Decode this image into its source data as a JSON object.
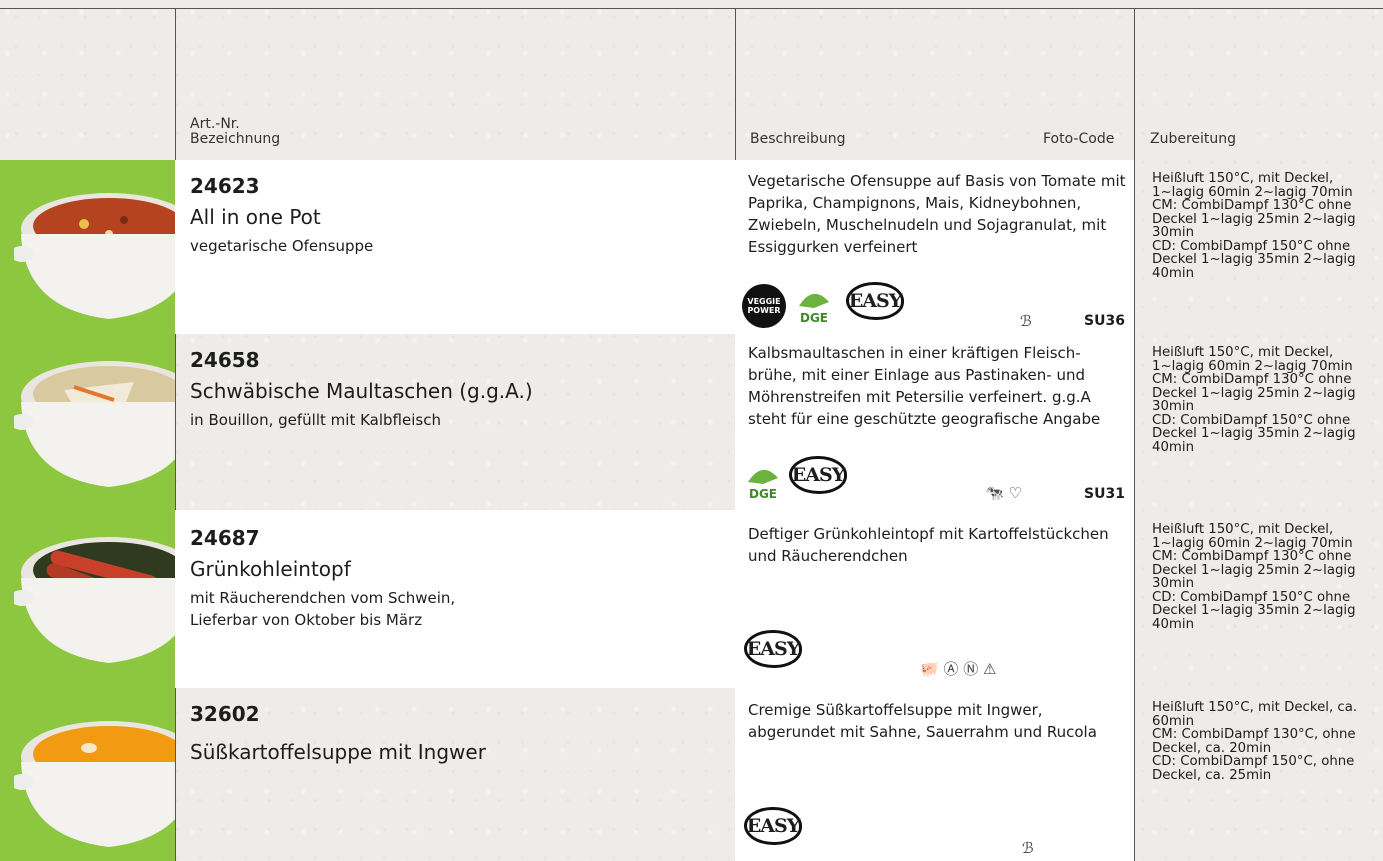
{
  "header": {
    "art_nr": "Art.-Nr.",
    "bezeichnung": "Bezeichnung",
    "beschreibung": "Beschreibung",
    "foto_code": "Foto-Code",
    "zubereitung": "Zubereitung"
  },
  "products": [
    {
      "art_nr": "24623",
      "name": "All in one Pot",
      "sub1": "vegetarische Ofensuppe",
      "sub2": "",
      "desc": "Vegetarische Ofensuppe auf Basis von Tomate mit Paprika, Champignons, Mais, Kidneybohnen, Zwiebeln, Muschelnudeln und Sojagranulat, mit Essiggurken verfeinert",
      "code": "SU36",
      "badges": [
        "VEGGIE POWER",
        "DGE",
        "EASY"
      ],
      "symbols": "ℬ",
      "zubereitung": [
        "Heißluft 150°C, mit Deckel,",
        "1~lagig 60min 2~lagig 70min",
        "CM: CombiDampf 130°C ohne",
        "Deckel 1~lagig 25min 2~lagig",
        "30min",
        "CD: CombiDampf 150°C ohne",
        "Deckel 1~lagig 35min 2~lagig",
        "40min"
      ]
    },
    {
      "art_nr": "24658",
      "name": "Schwäbische Maultaschen (g.g.A.)",
      "sub1": "in Bouillon, gefüllt mit Kalbfleisch",
      "sub2": "",
      "desc": "Kalbsmaultaschen in einer kräftigen Fleisch-brühe, mit einer Einlage aus Pastinaken- und Möhrenstreifen mit Petersilie verfeinert. g.g.A steht für eine geschützte geografische Angabe",
      "code": "SU31",
      "badges": [
        "DGE",
        "EASY"
      ],
      "symbols": "🐄 ♡",
      "zubereitung": [
        "Heißluft 150°C, mit Deckel,",
        "1~lagig 60min 2~lagig 70min",
        "CM: CombiDampf 130°C ohne",
        "Deckel 1~lagig 25min 2~lagig",
        "30min",
        "CD: CombiDampf 150°C ohne",
        "Deckel 1~lagig 35min 2~lagig",
        "40min"
      ]
    },
    {
      "art_nr": "24687",
      "name": "Grünkohleintopf",
      "sub1": "mit Räucherendchen vom Schwein,",
      "sub2": "Lieferbar von Oktober bis März",
      "desc": "Deftiger Grünkohleintopf mit Kartoffelstückchen und Räucherendchen",
      "code": "",
      "badges": [
        "EASY"
      ],
      "symbols": "🐖 Ⓐ Ⓝ ⚠",
      "zubereitung": [
        "Heißluft 150°C, mit Deckel,",
        "1~lagig 60min 2~lagig 70min",
        "CM: CombiDampf 130°C ohne",
        "Deckel 1~lagig 25min 2~lagig",
        "30min",
        "CD: CombiDampf 150°C ohne",
        "Deckel 1~lagig 35min 2~lagig",
        "40min"
      ]
    },
    {
      "art_nr": "32602",
      "name": "Süßkartoffelsuppe mit Ingwer",
      "sub1": "",
      "sub2": "",
      "desc": "Cremige Süßkartoffelsuppe mit Ingwer, abgerundet mit Sahne, Sauerrahm und Rucola",
      "code": "",
      "badges": [
        "EASY"
      ],
      "symbols": "ℬ",
      "zubereitung": [
        "Heißluft 150°C, mit Deckel, ca.",
        "60min",
        "CM: CombiDampf 130°C, ohne",
        "Deckel, ca. 20min",
        "CD: CombiDampf 150°C, ohne",
        "Deckel, ca. 25min"
      ]
    }
  ],
  "colors": {
    "green": "#8dc63f",
    "soup1": "#b5431f",
    "soup2": "#d9c9a0",
    "soup3": "#2f3a1f",
    "soup4": "#f19a12"
  }
}
